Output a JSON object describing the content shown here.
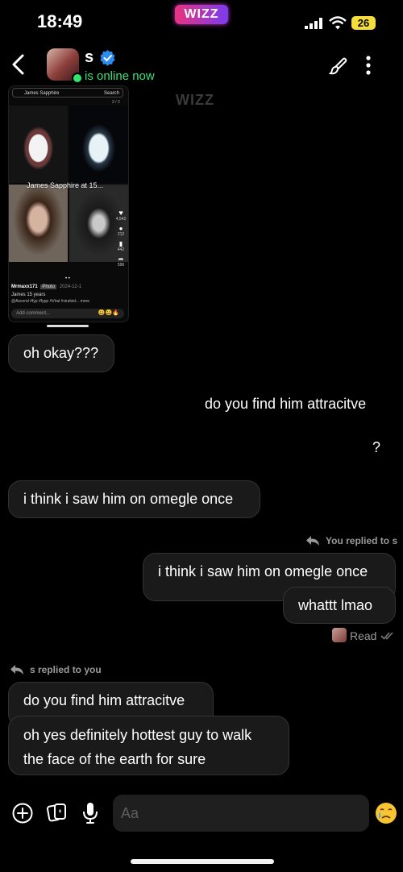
{
  "status_bar": {
    "time": "18:49",
    "battery": "26",
    "app_badge": "WIZZ"
  },
  "header": {
    "contact_name": "s",
    "online_status": "is online now"
  },
  "attachment": {
    "search_text": "James Sapphire",
    "search_button": "Search",
    "page_indicator": "2 / 2",
    "caption": "James Sapphire at 15...",
    "side_counts": [
      "4,542",
      "212",
      "442",
      "596"
    ],
    "username": "Mrmaxx171",
    "post_type": "Photo",
    "post_date": "2024-12-1",
    "post_title": "James 15 years",
    "post_tags": "@Ascend #fyp #fypp #Viral #viralvid... more",
    "comment_placeholder": "Add comment..."
  },
  "watermark": "WIZZ",
  "messages": {
    "m1": "oh okay???",
    "m2": "do you find him attracitve",
    "m3": "?",
    "m4": "i think i saw him on omegle once",
    "reply_label_you": "You replied to s",
    "m5_quote": "i think i saw him on omegle once",
    "m5": "whattt lmao",
    "read_status": "Read",
    "reply_label_s": "s replied to you",
    "m6_quote": "do you find him attracitve",
    "m6_line1": "oh yes definitely hottest guy to walk",
    "m6_line2": "the face of the earth for sure"
  },
  "composer": {
    "placeholder": "Aa"
  },
  "colors": {
    "online_green": "#37e27a",
    "bubble_bg": "#1a1a1a",
    "wizz_pink": "#e8347d",
    "battery_yellow": "#f5dd3c"
  }
}
